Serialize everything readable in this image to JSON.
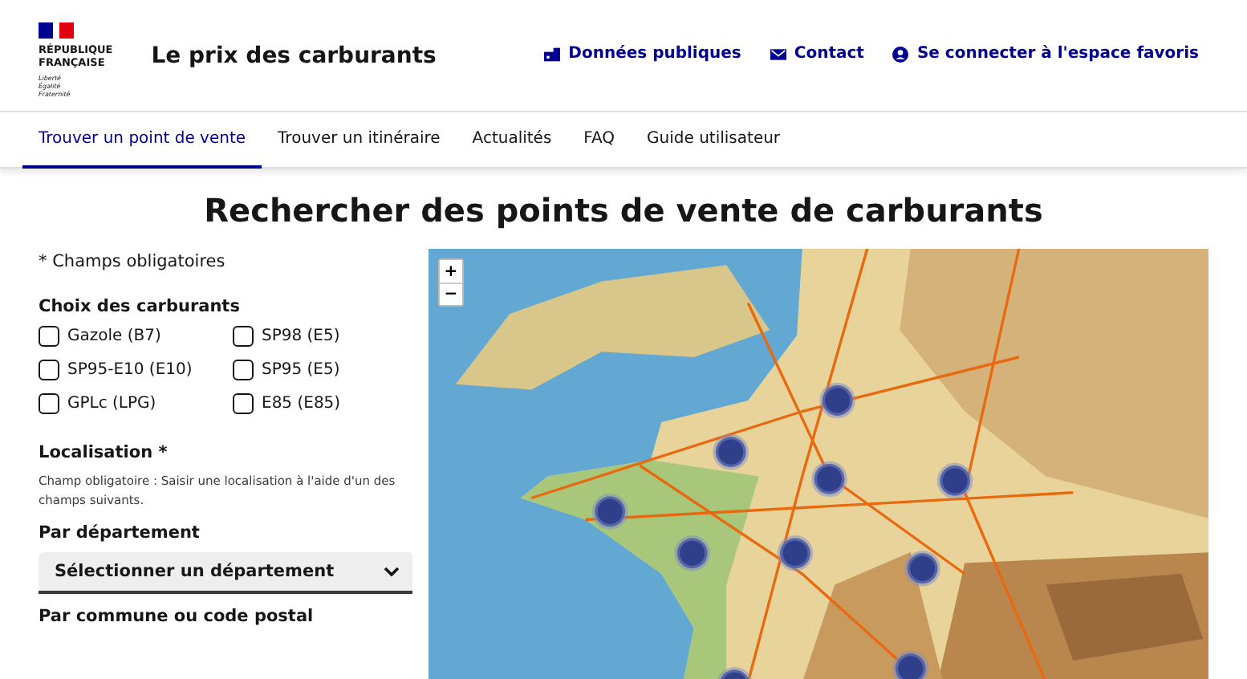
{
  "header": {
    "logo_lines": [
      "RÉPUBLIQUE",
      "FRANÇAISE"
    ],
    "motto": [
      "Liberté",
      "Égalité",
      "Fraternité"
    ],
    "site_title": "Le prix des carburants",
    "links": [
      {
        "label": "Données publiques",
        "kind": "data"
      },
      {
        "label": "Contact",
        "kind": "mail"
      },
      {
        "label": "Se connecter à l'espace favoris",
        "kind": "user"
      }
    ]
  },
  "nav": [
    {
      "label": "Trouver un point de vente",
      "selected": true
    },
    {
      "label": "Trouver un itinéraire",
      "selected": false
    },
    {
      "label": "Actualités",
      "selected": false
    },
    {
      "label": "FAQ",
      "selected": false
    },
    {
      "label": "Guide utilisateur",
      "selected": false
    }
  ],
  "page_title": "Rechercher des points de vente de carburants",
  "required_note": "* Champs obligatoires",
  "fuel_title": "Choix des carburants",
  "fuels": [
    {
      "label": "Gazole (B7)",
      "checked": false
    },
    {
      "label": "SP98 (E5)",
      "checked": false
    },
    {
      "label": "SP95-E10 (E10)",
      "checked": false
    },
    {
      "label": "SP95 (E5)",
      "checked": false
    },
    {
      "label": "GPLc (LPG)",
      "checked": false
    },
    {
      "label": "E85 (E85)",
      "checked": false
    }
  ],
  "location_title": "Localisation *",
  "location_hint": "Champ obligatoire : Saisir une localisation à l'aide d'un des champs suivants.",
  "department_label": "Par département",
  "department_select": "Sélectionner un département",
  "commune_label": "Par commune ou code postal",
  "map": {
    "zoom_in": "+",
    "zoom_out": "−"
  }
}
